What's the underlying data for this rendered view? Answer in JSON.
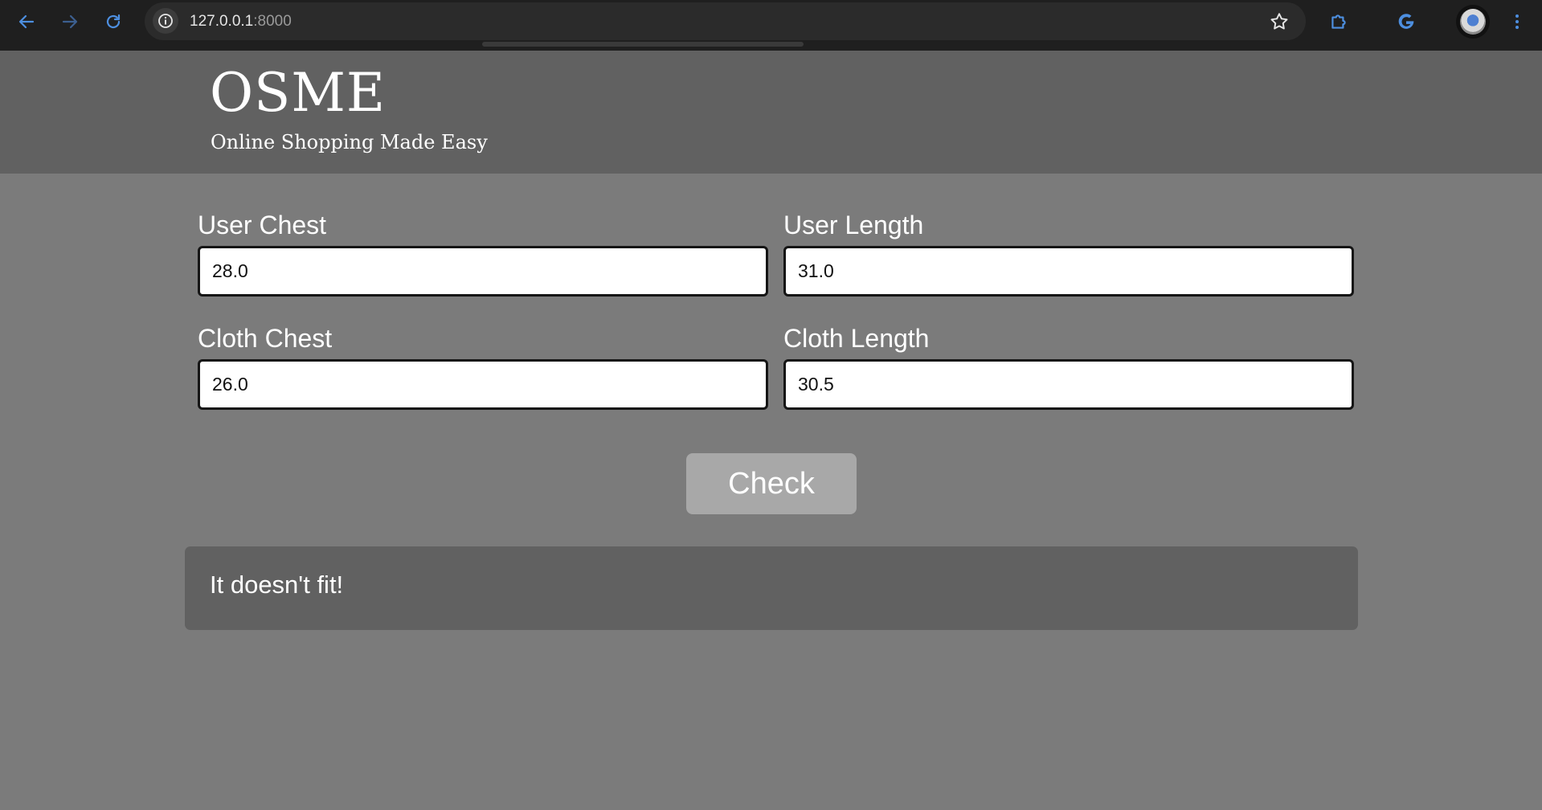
{
  "browser": {
    "url_host": "127.0.0.1",
    "url_port": ":8000",
    "icons": {
      "back": "arrow-left-icon",
      "forward": "arrow-right-icon",
      "reload": "reload-icon",
      "site_info": "info-icon",
      "bookmark": "star-icon",
      "extensions": "puzzle-icon",
      "google": "google-icon",
      "menu": "kebab-menu-icon"
    },
    "accent_color": "#4d8fe0"
  },
  "header": {
    "brand": "OSME",
    "tagline": "Online Shopping Made Easy"
  },
  "form": {
    "user_chest": {
      "label": "User Chest",
      "value": "28.0"
    },
    "user_length": {
      "label": "User Length",
      "value": "31.0"
    },
    "cloth_chest": {
      "label": "Cloth Chest",
      "value": "26.0"
    },
    "cloth_length": {
      "label": "Cloth Length",
      "value": "30.5"
    },
    "submit_label": "Check"
  },
  "result": {
    "message": "It doesn't fit!"
  }
}
